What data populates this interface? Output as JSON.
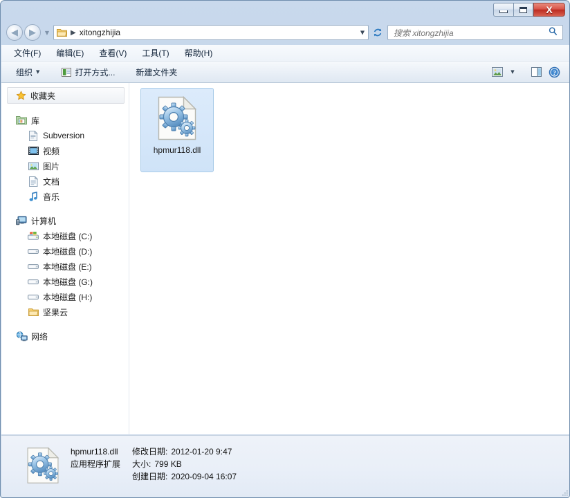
{
  "window": {
    "caption": {
      "minimize_tooltip": "最小化",
      "maximize_tooltip": "最大化",
      "close_label": "X"
    }
  },
  "navbar": {
    "back_glyph": "◀",
    "forward_glyph": "▶",
    "recent_caret": "▼",
    "address": {
      "crumb": "xitongzhijia",
      "separator": "▶",
      "dropdown_caret": "▼"
    },
    "refresh_glyph": "↻",
    "search": {
      "placeholder": "搜索 xitongzhijia",
      "icon_glyph": "⌕"
    }
  },
  "menubar": {
    "items": [
      {
        "label": "文件(F)"
      },
      {
        "label": "编辑(E)"
      },
      {
        "label": "查看(V)"
      },
      {
        "label": "工具(T)"
      },
      {
        "label": "帮助(H)"
      }
    ]
  },
  "toolbar": {
    "organize_label": "组织",
    "organize_caret": "▼",
    "open_with_label": "打开方式...",
    "new_folder_label": "新建文件夹",
    "view_caret": "▼",
    "help_glyph": "?"
  },
  "navpane": {
    "favorites": {
      "label": "收藏夹"
    },
    "libraries": {
      "label": "库",
      "items": [
        {
          "label": "Subversion",
          "icon": "subversion-icon"
        },
        {
          "label": "视频",
          "icon": "video-icon"
        },
        {
          "label": "图片",
          "icon": "pictures-icon"
        },
        {
          "label": "文档",
          "icon": "documents-icon"
        },
        {
          "label": "音乐",
          "icon": "music-icon"
        }
      ]
    },
    "computer": {
      "label": "计算机",
      "items": [
        {
          "label": "本地磁盘 (C:)",
          "icon": "system-drive-icon"
        },
        {
          "label": "本地磁盘 (D:)",
          "icon": "drive-icon"
        },
        {
          "label": "本地磁盘 (E:)",
          "icon": "drive-icon"
        },
        {
          "label": "本地磁盘 (G:)",
          "icon": "drive-icon"
        },
        {
          "label": "本地磁盘 (H:)",
          "icon": "drive-icon"
        },
        {
          "label": "坚果云",
          "icon": "folder-icon"
        }
      ]
    },
    "network": {
      "label": "网络"
    }
  },
  "content": {
    "files": [
      {
        "name": "hpmur118.dll",
        "selected": true,
        "icon": "dll-gear-icon"
      }
    ]
  },
  "statusbar": {
    "file_name": "hpmur118.dll",
    "file_type": "应用程序扩展",
    "modified_key": "修改日期:",
    "modified_value": "2012-01-20 9:47",
    "size_key": "大小:",
    "size_value": "799 KB",
    "created_key": "创建日期:",
    "created_value": "2020-09-04 16:07"
  },
  "colors": {
    "selection_fill": "#d5e6f9",
    "selection_border": "#a8cbe8",
    "frame": "#c9d9ec",
    "accent_blue": "#2b6aa8"
  }
}
